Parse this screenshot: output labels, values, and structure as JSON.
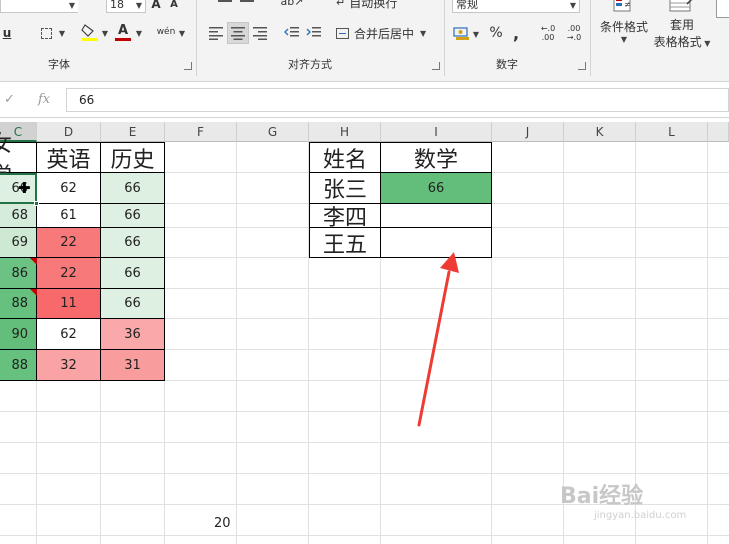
{
  "ribbon": {
    "font_size_value": "18",
    "font_label": "字体",
    "align_label": "对齐方式",
    "number_label": "数字",
    "wrap_text_label": "自动换行",
    "merge_center_label": "合并后居中",
    "number_format_value": "常规",
    "percent_label": "%",
    "comma_label": ",",
    "cond_format_label": "条件格式",
    "table_format_label": "套用",
    "table_format_label2": "表格格式",
    "underline_label": "u",
    "font_grow_label": "A",
    "font_shrink_label": "A",
    "font_color_label": "A",
    "phonetic_label": "wén",
    "inc_decimal_label": "←.0 .00",
    "dec_decimal_label": ".00 →.0"
  },
  "formula_bar": {
    "cancel_icon": "check-icon",
    "fx_label": "fx",
    "value": "66"
  },
  "columns": [
    "C",
    "D",
    "E",
    "F",
    "G",
    "H",
    "I",
    "J",
    "K",
    "L"
  ],
  "selected_column": "C",
  "scores_table": {
    "headers": [
      "数学",
      "英语",
      "历史"
    ],
    "header_math_partial": "女学",
    "rows": [
      {
        "math": "66",
        "english": "62",
        "history": "66"
      },
      {
        "math": "68",
        "english": "61",
        "history": "66"
      },
      {
        "math": "69",
        "english": "22",
        "history": "66"
      },
      {
        "math": "86",
        "english": "22",
        "history": "66"
      },
      {
        "math": "88",
        "english": "11",
        "history": "66"
      },
      {
        "math": "90",
        "english": "62",
        "history": "36"
      },
      {
        "math": "88",
        "english": "32",
        "history": "31"
      }
    ]
  },
  "lookup_table": {
    "header_name": "姓名",
    "header_math": "数学",
    "rows": [
      {
        "name": "张三",
        "math": "66"
      },
      {
        "name": "李四",
        "math": ""
      },
      {
        "name": "王五",
        "math": ""
      }
    ]
  },
  "floating_value": "20",
  "colors": {
    "green_strong": "#63be7b",
    "green_light": "#def0e1",
    "red_strong": "#f8696b",
    "red_mid": "#f78a8b",
    "red_light": "#faa3a4",
    "white": "#ffffff",
    "accent": "#217346",
    "arrow": "#ee3b34"
  },
  "watermark": {
    "brand": "Bai经验",
    "url": "jingyan.baidu.com"
  }
}
